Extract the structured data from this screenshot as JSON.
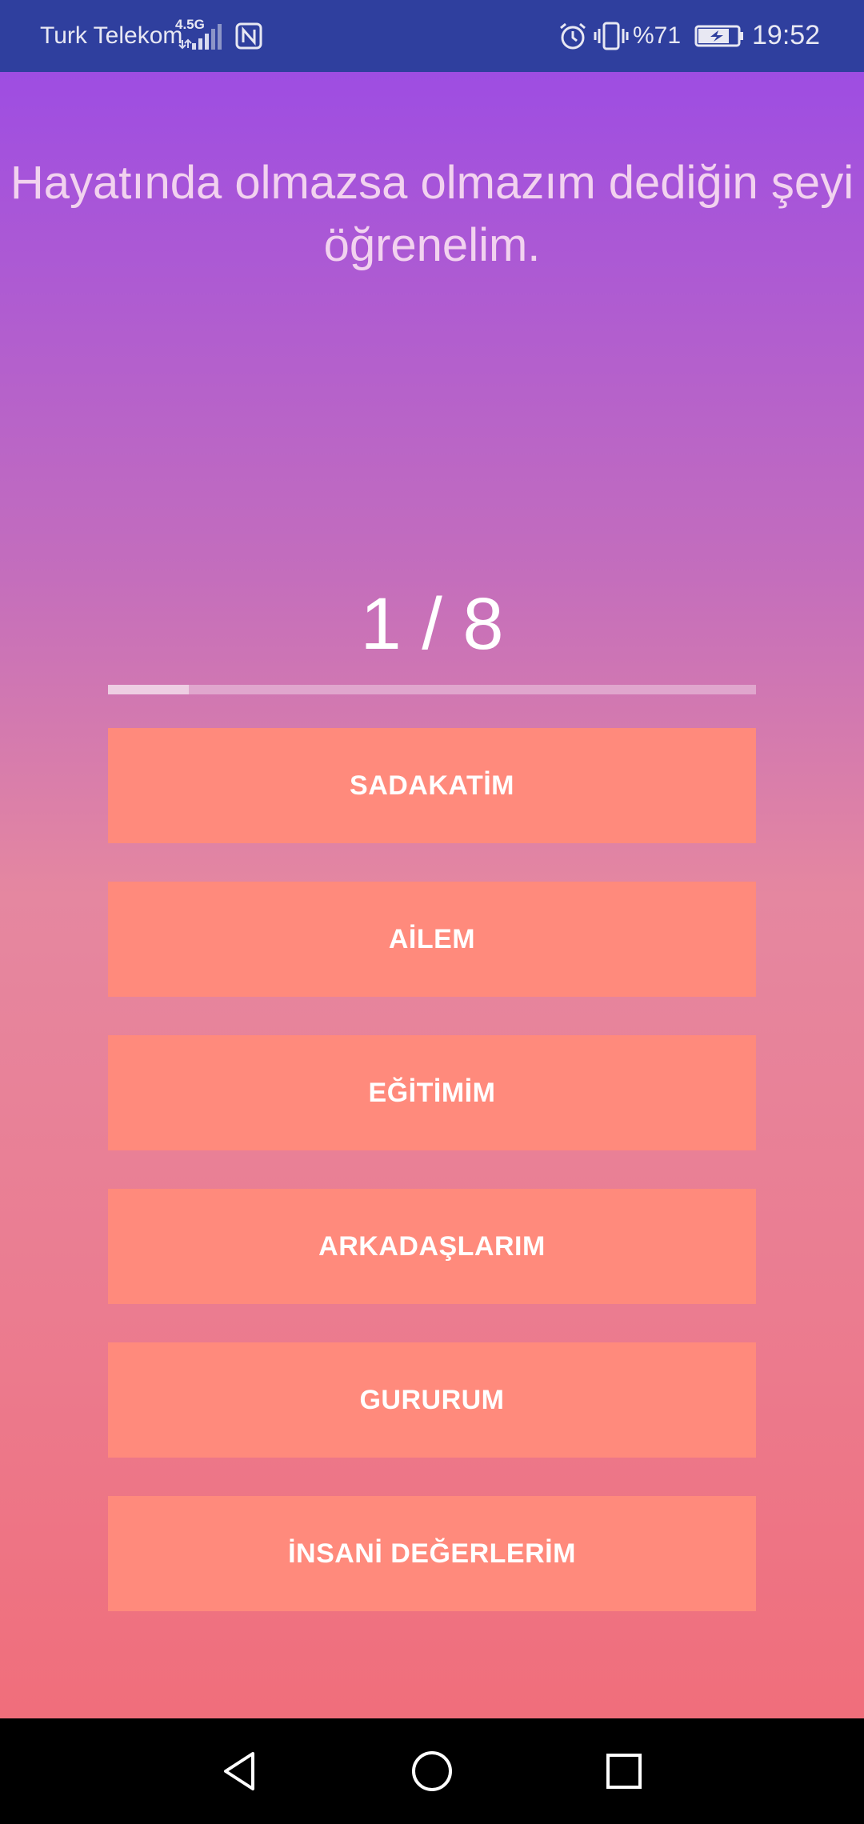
{
  "status_bar": {
    "carrier": "Turk Telekom",
    "network_type": "4.5G",
    "battery_percent": "%71",
    "time": "19:52",
    "icons": [
      "signal-icon",
      "nfc-icon",
      "alarm-icon",
      "vibrate-icon",
      "battery-charging-icon"
    ]
  },
  "quiz": {
    "question": "Hayatında olmazsa olmazım dediğin şeyi öğrenelim.",
    "progress_label": "1 / 8",
    "progress_fraction": 0.125,
    "options": [
      {
        "label": "SADAKATİM"
      },
      {
        "label": "AİLEM"
      },
      {
        "label": "EĞİTİMİM"
      },
      {
        "label": "ARKADAŞLARIM"
      },
      {
        "label": "GURURUM"
      },
      {
        "label": "İNSANİ DEĞERLERİM"
      }
    ]
  },
  "colors": {
    "status_bar": "#2f3f9e",
    "gradient_top": "#9e4de2",
    "gradient_bottom": "#f06e7b",
    "button": "#ff8a7c",
    "question_text": "#f2d2ef"
  },
  "nav_bar": {
    "icons": [
      "back-icon",
      "home-icon",
      "recent-apps-icon"
    ]
  }
}
